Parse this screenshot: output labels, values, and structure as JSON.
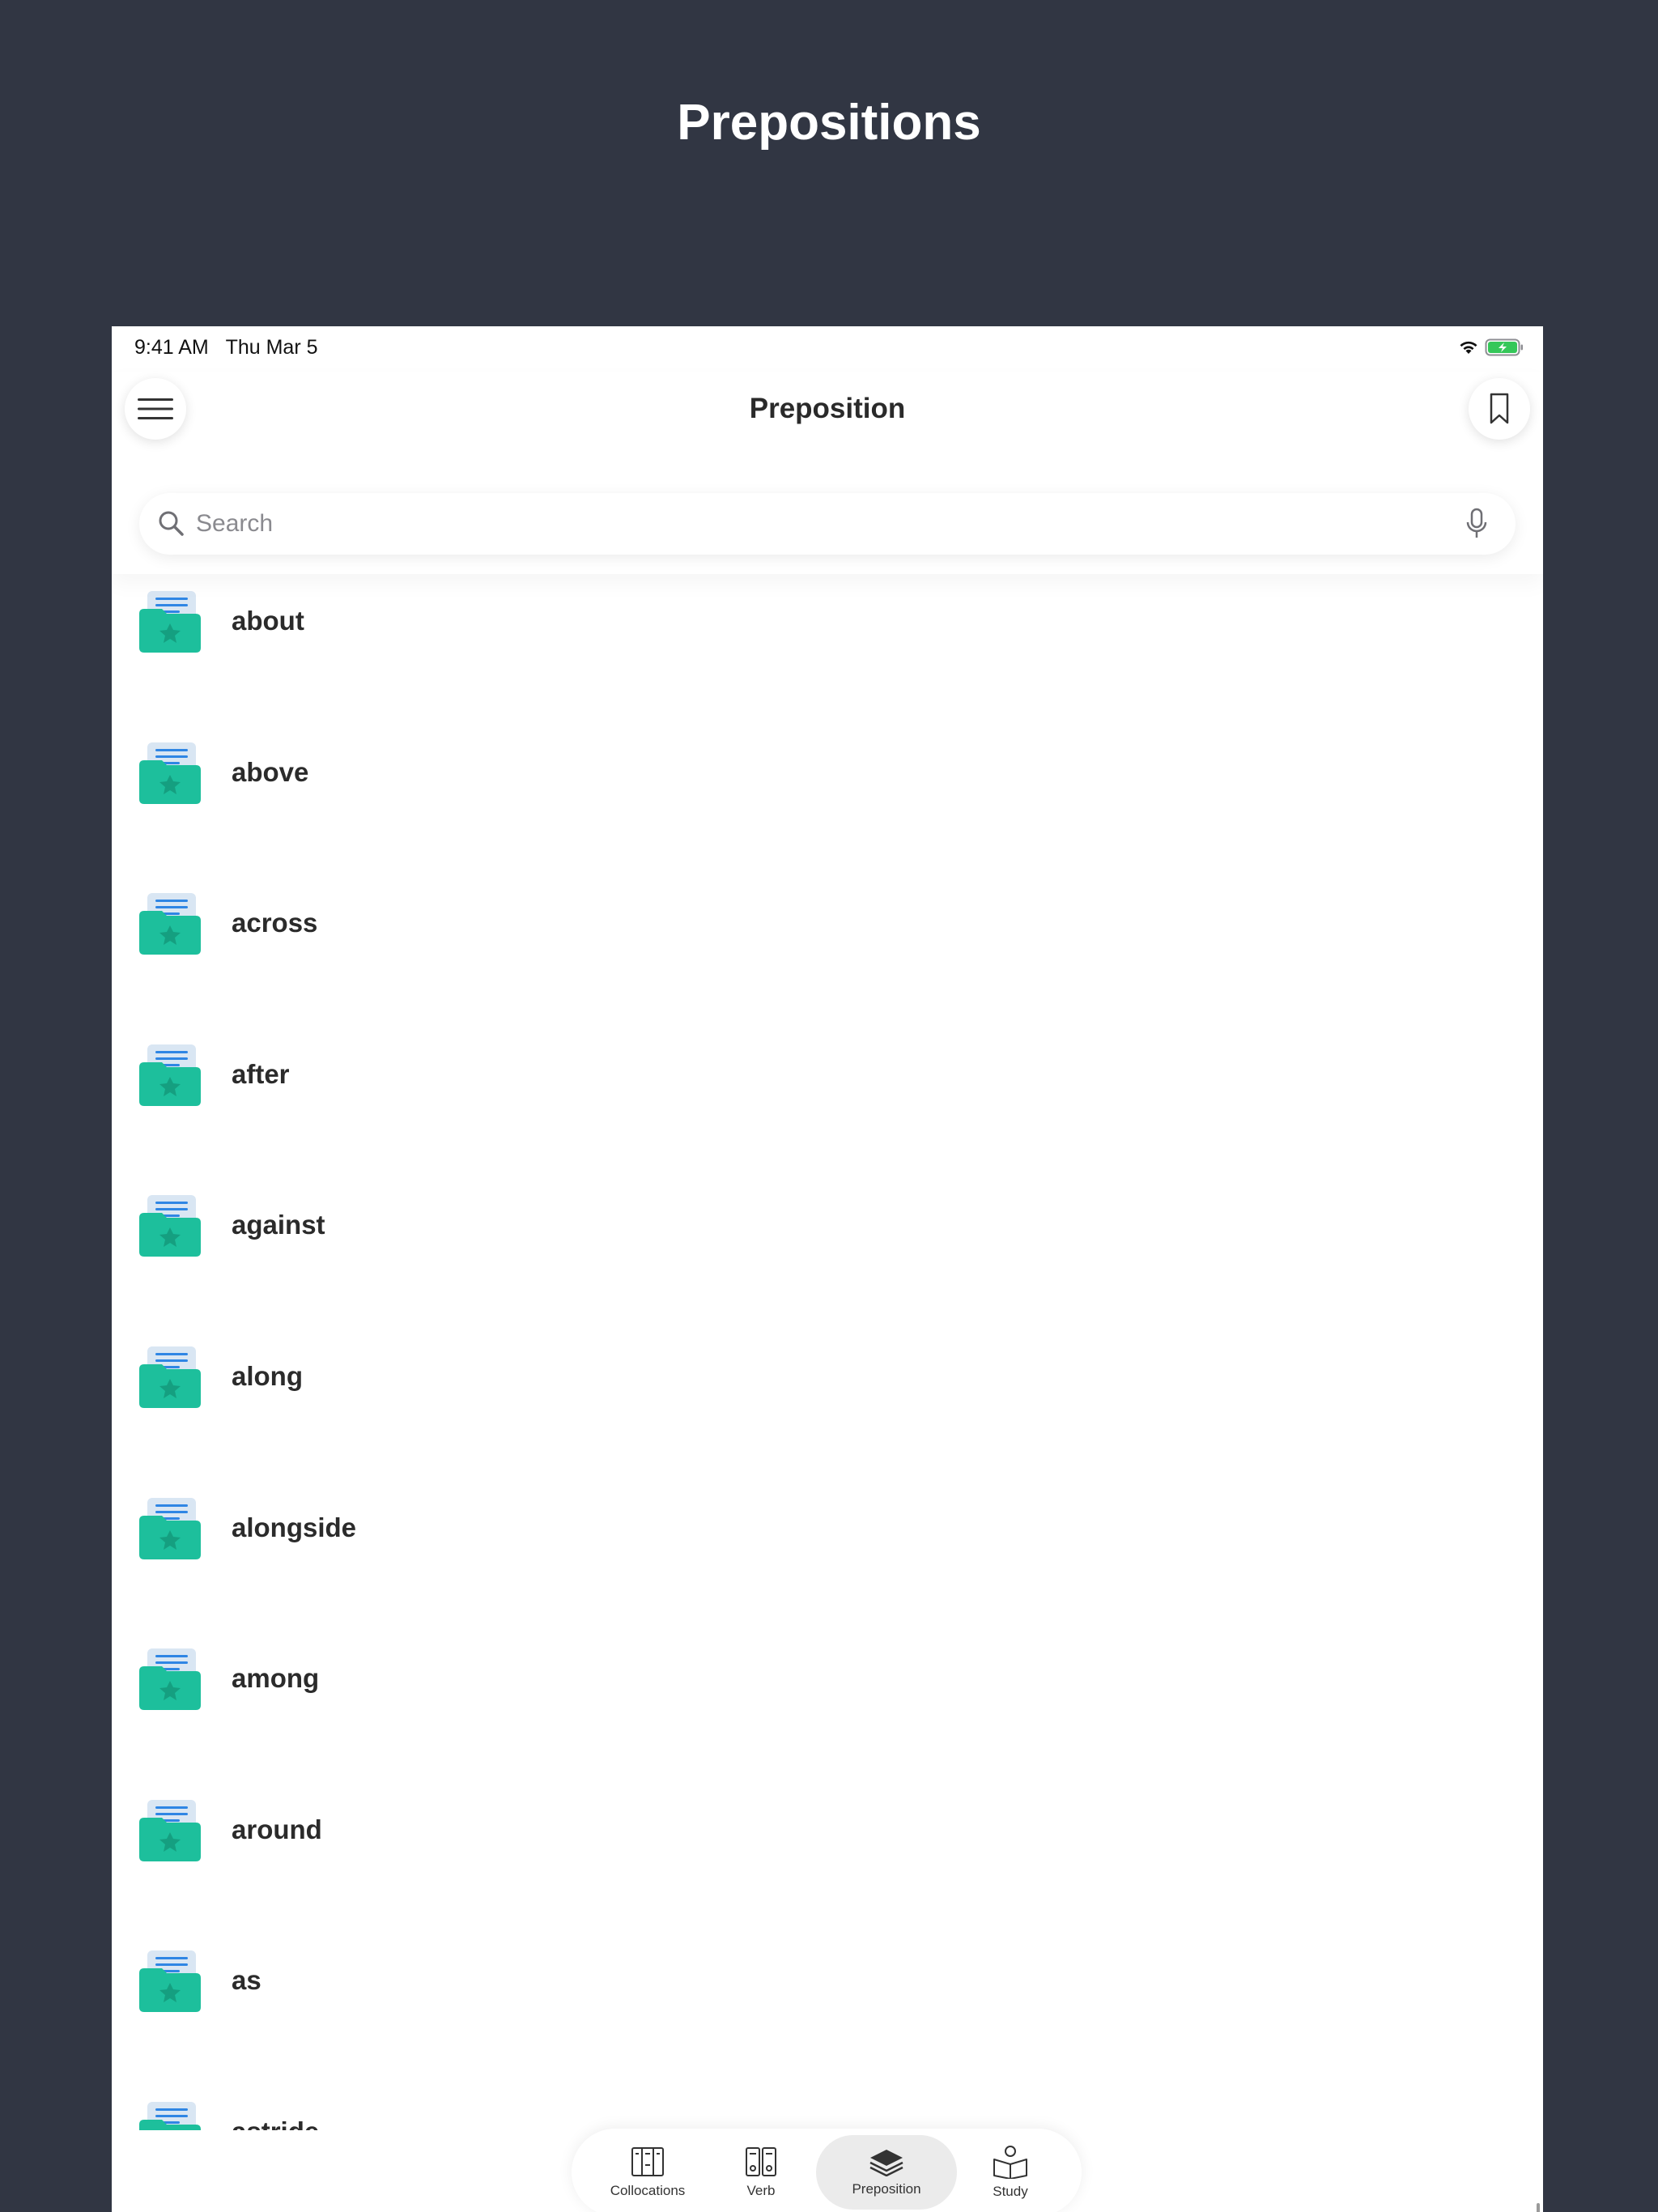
{
  "promo": {
    "title": "Prepositions"
  },
  "status_bar": {
    "time": "9:41 AM",
    "date": "Thu Mar 5",
    "wifi_icon": "wifi-icon",
    "battery_icon": "battery-charging-icon",
    "battery_color": "#35c759"
  },
  "header": {
    "title": "Preposition",
    "menu_icon": "hamburger-menu-icon",
    "bookmark_icon": "bookmark-icon"
  },
  "search": {
    "placeholder": "Search",
    "value": "",
    "search_icon": "magnifier-icon",
    "mic_icon": "microphone-icon"
  },
  "list": {
    "item_icon": "folder-document-star-icon",
    "items": [
      {
        "label": "about"
      },
      {
        "label": "above"
      },
      {
        "label": "across"
      },
      {
        "label": "after"
      },
      {
        "label": "against"
      },
      {
        "label": "along"
      },
      {
        "label": "alongside"
      },
      {
        "label": "among"
      },
      {
        "label": "around"
      },
      {
        "label": "as"
      },
      {
        "label": "astride"
      }
    ]
  },
  "tabs": [
    {
      "label": "Collocations",
      "icon": "books-icon",
      "active": false
    },
    {
      "label": "Verb",
      "icon": "binders-icon",
      "active": false
    },
    {
      "label": "Preposition",
      "icon": "layers-icon",
      "active": true
    },
    {
      "label": "Study",
      "icon": "reading-person-icon",
      "active": false
    }
  ],
  "colors": {
    "background": "#313643",
    "folder": "#1dbf9c",
    "folder_dark": "#159f80",
    "doc": "#d9e6f3",
    "doc_lines": "#2f86e4"
  }
}
